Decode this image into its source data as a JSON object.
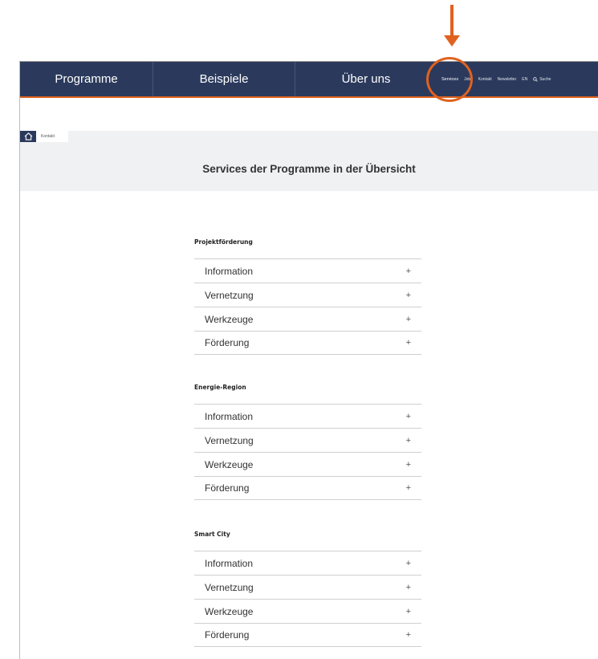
{
  "nav": {
    "main": [
      "Programme",
      "Beispiele",
      "Über uns"
    ],
    "meta": [
      "Services",
      "Jobs",
      "Kontakt",
      "Newsletter",
      "EN",
      "Suche"
    ]
  },
  "breadcrumb": {
    "current": "Kontakt"
  },
  "page_title": "Services der Programme in der Übersicht",
  "sections": [
    {
      "title": "Projektförderung",
      "items": [
        "Information",
        "Vernetzung",
        "Werkzeuge",
        "Förderung"
      ]
    },
    {
      "title": "Energie-Region",
      "items": [
        "Information",
        "Vernetzung",
        "Werkzeuge",
        "Förderung"
      ]
    },
    {
      "title": "Smart City",
      "items": [
        "Information",
        "Vernetzung",
        "Werkzeuge",
        "Förderung"
      ]
    }
  ],
  "accordion_toggle": "+",
  "colors": {
    "navbar": "#2b3a5c",
    "accent": "#e0621f",
    "band": "#f0f1f2"
  },
  "icons": {
    "home": "home-icon",
    "search": "search-icon",
    "annotation_arrow": "arrow-down-icon"
  }
}
